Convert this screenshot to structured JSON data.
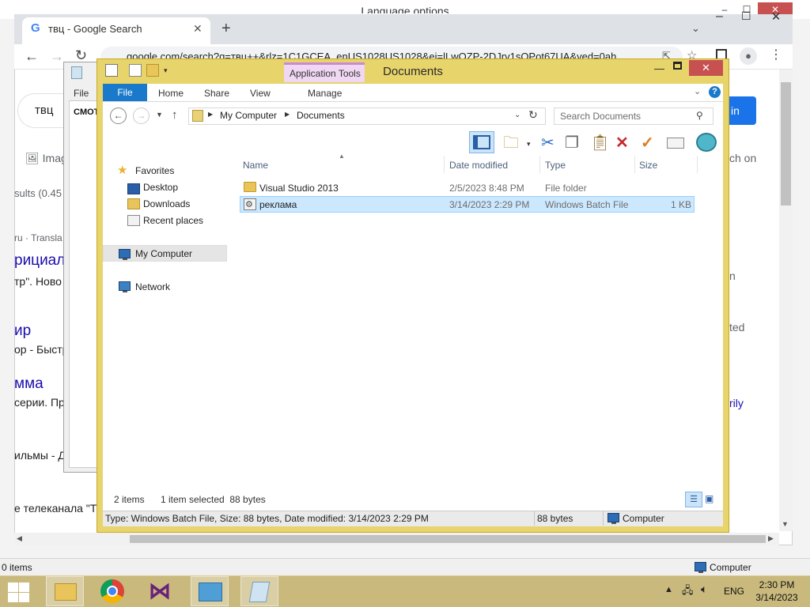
{
  "background_window": {
    "title": "Language options",
    "status_items": "0 items",
    "status_location": "Computer"
  },
  "chrome": {
    "tab_title": "твц - Google Search",
    "url": "google.com/search?q=твц++&rlz=1C1GCEA_enUS1028US1028&ei=lLwOZP-2DJrv1sQPot67UA&ved=0ah",
    "search_query": "твц",
    "signin_label": "in",
    "images_label": "Imag",
    "fragments": {
      "results": "sults (0.45",
      "translate": "ru · Transla",
      "title1": "рициал",
      "snippet1": "тр\". Ново",
      "title2": "ир",
      "snippet2": "ор - Быстр",
      "title3": "мма",
      "snippet3": "серии. Пр",
      "snippet4": "ильмы - Д",
      "snippet5": "е телеканала \"ТВ",
      "right1": "ch on",
      "right2": "n",
      "right3": "ted",
      "right4": "rily"
    }
  },
  "doc_window": {
    "menu_file": "File",
    "text": "CMOT"
  },
  "explorer": {
    "title": "Documents",
    "context_tab": "Application Tools",
    "ribbon_tabs": [
      "File",
      "Home",
      "Share",
      "View",
      "Manage"
    ],
    "breadcrumb": [
      "My Computer",
      "Documents"
    ],
    "search_placeholder": "Search Documents",
    "nav": {
      "favorites": "Favorites",
      "desktop": "Desktop",
      "downloads": "Downloads",
      "recent": "Recent places",
      "my_computer": "My Computer",
      "network": "Network"
    },
    "columns": [
      "Name",
      "Date modified",
      "Type",
      "Size"
    ],
    "files": [
      {
        "name": "Visual Studio 2013",
        "date": "2/5/2023 8:48 PM",
        "type": "File folder",
        "size": ""
      },
      {
        "name": "реклама",
        "date": "3/14/2023 2:29 PM",
        "type": "Windows Batch File",
        "size": "1 KB"
      }
    ],
    "status": {
      "count": "2 items",
      "selected": "1 item selected  88 bytes"
    },
    "bottom_status": {
      "description": "Type: Windows Batch File, Size: 88 bytes, Date modified: 3/14/2023 2:29 PM",
      "size": "88 bytes",
      "location": "Computer"
    }
  },
  "taskbar": {
    "language": "ENG",
    "time": "2:30 PM",
    "date": "3/14/2023"
  },
  "colors": {
    "explorer_frame": "#e7d46a",
    "ribbon_file": "#1979ca",
    "selection": "#cce8ff",
    "taskbar": "#c9b97d"
  }
}
